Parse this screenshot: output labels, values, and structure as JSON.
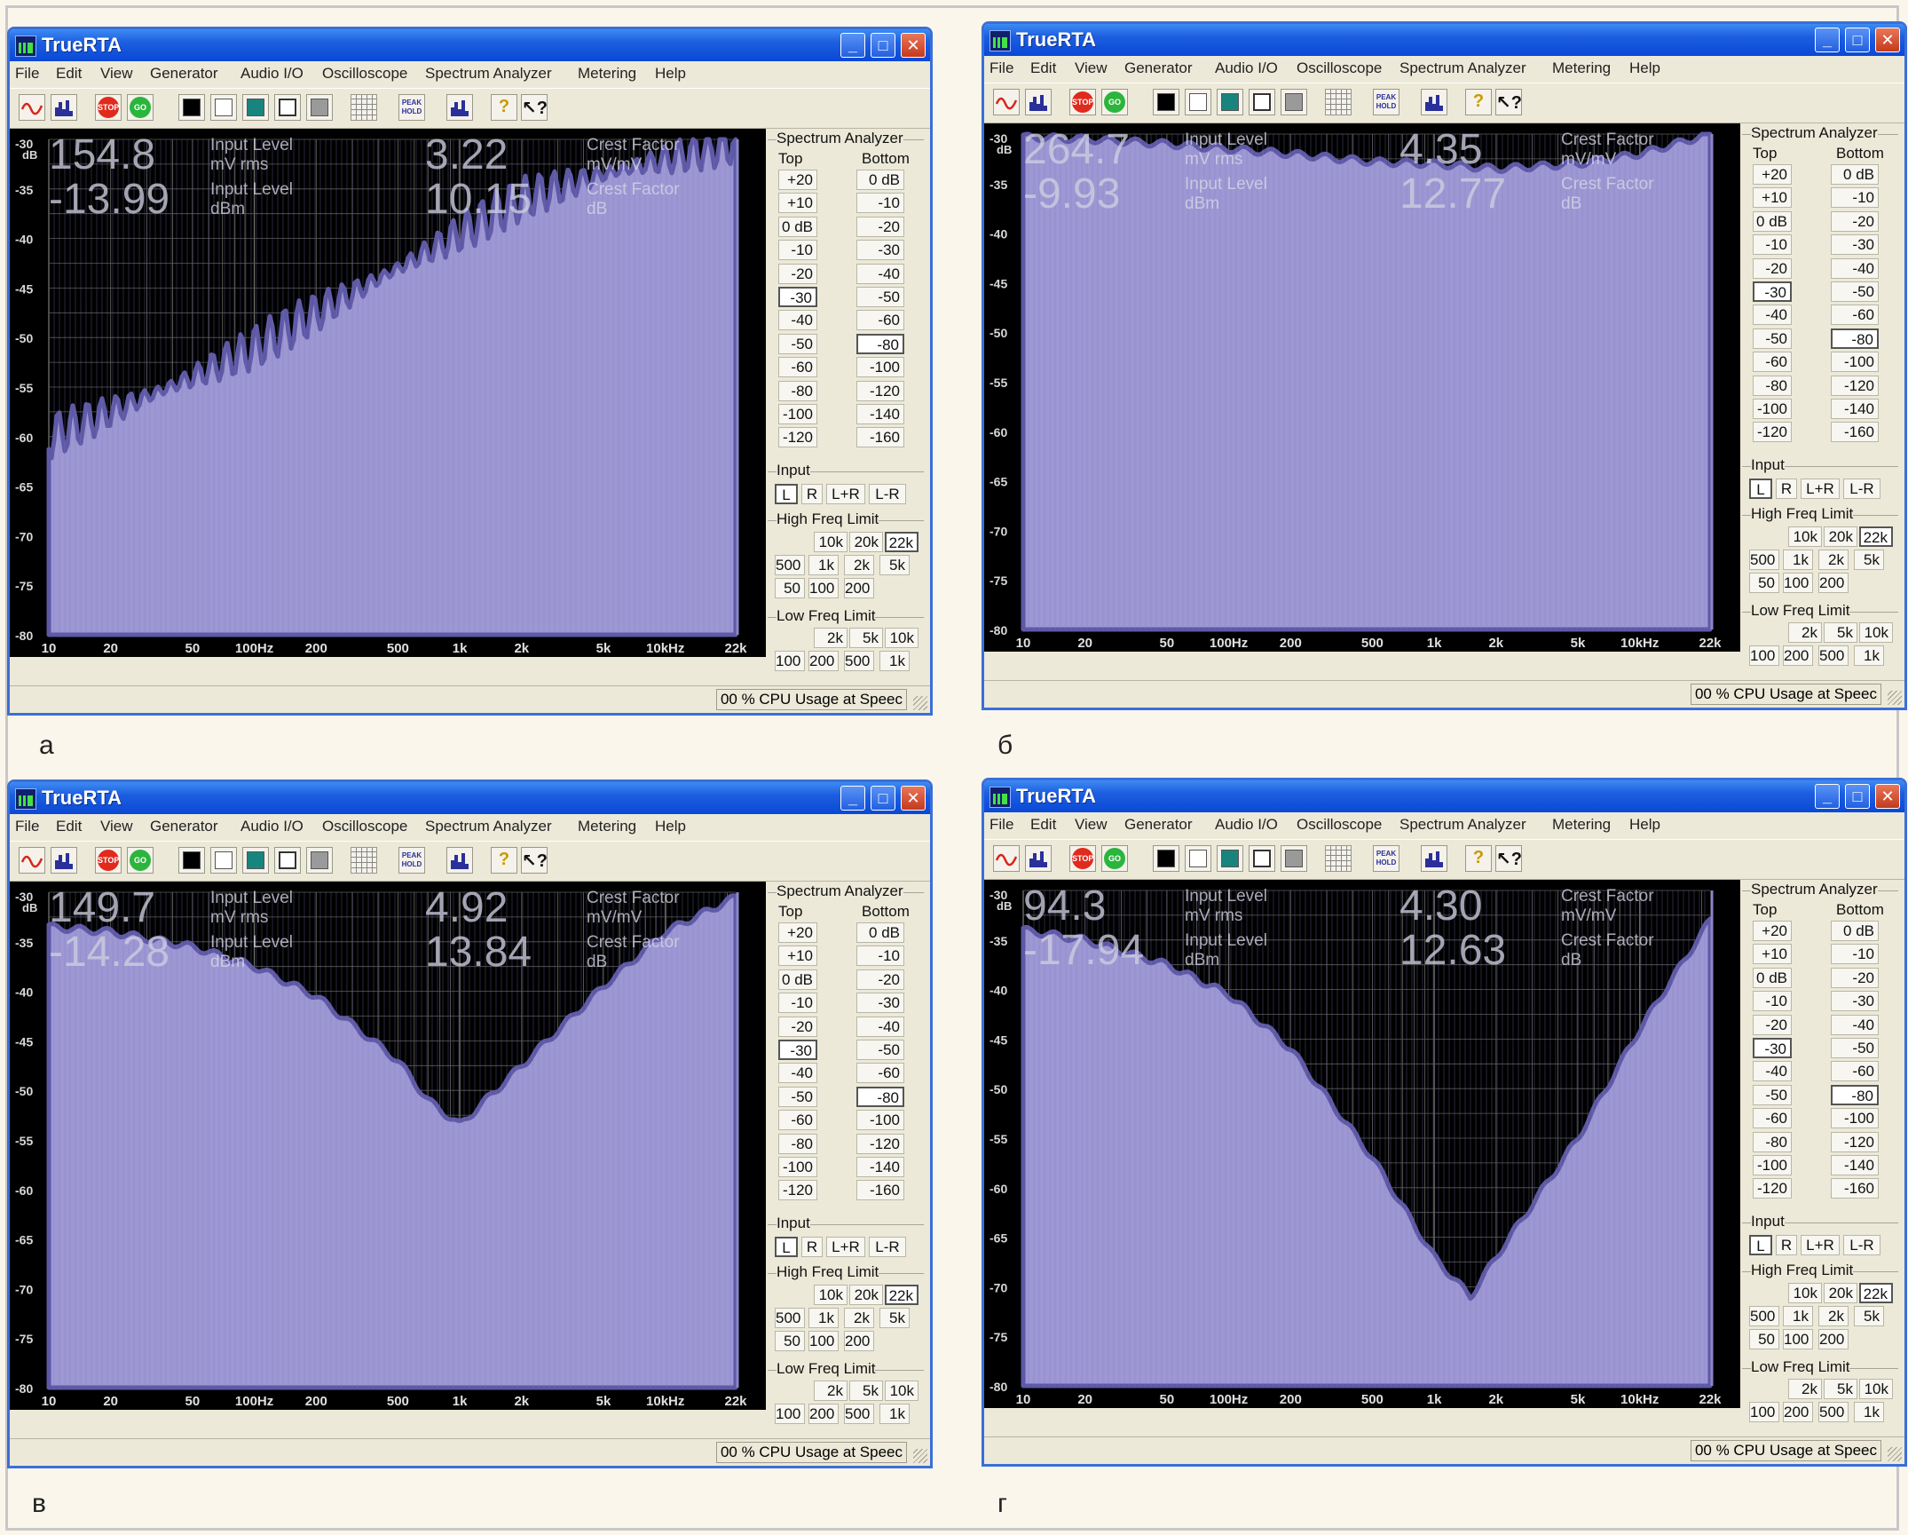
{
  "panel_labels": [
    "а",
    "б",
    "в",
    "г"
  ],
  "window": {
    "title": "TrueRTA",
    "menu": [
      "File",
      "Edit",
      "View",
      "Generator",
      "Audio I/O",
      "Oscilloscope",
      "Spectrum Analyzer",
      "Metering",
      "Help"
    ],
    "controls": {
      "minimize": "_",
      "maximize": "□",
      "close": "✕"
    }
  },
  "toolbar_icons": [
    "sine-wave-icon",
    "spectrum-icon",
    "stop-icon",
    "go-icon",
    "black-background-swatch",
    "white-background-swatch",
    "teal-background-swatch",
    "white-outline-swatch",
    "gray-background-swatch",
    "grid-icon",
    "peak-hold-icon",
    "bar-graph-icon",
    "help-icon",
    "context-help-icon"
  ],
  "toolbar_text": {
    "stop": "STOP",
    "go": "GO",
    "peak_hold": "PEAK HOLD",
    "help": "?",
    "context_help": "↖?"
  },
  "graph": {
    "y_axis_unit": "dB",
    "y_ticks": [
      "-30",
      "-35",
      "-40",
      "-45",
      "-50",
      "-55",
      "-60",
      "-65",
      "-70",
      "-75",
      "-80"
    ],
    "x_ticks": [
      "10",
      "20",
      "50",
      "100Hz",
      "200",
      "500",
      "1k",
      "2k",
      "5k",
      "10kHz",
      "22k"
    ],
    "labels": {
      "input_level_mv": "Input Level",
      "mv_rms": "mV rms",
      "input_level_dbm": "Input Level",
      "dbm": "dBm",
      "crest_factor_ratio": "Crest Factor",
      "mv_per_mv": "mV/mV",
      "crest_factor_db": "Crest Factor",
      "db": "dB"
    }
  },
  "side_panel": {
    "spectrum_analyzer": "Spectrum Analyzer",
    "top_label": "Top",
    "bottom_label": "Bottom",
    "top_buttons": [
      "+20",
      "+10",
      "0 dB",
      "-10",
      "-20",
      "-30",
      "-40",
      "-50",
      "-60",
      "-80",
      "-100",
      "-120"
    ],
    "bottom_buttons": [
      "0 dB",
      "-10",
      "-20",
      "-30",
      "-40",
      "-50",
      "-60",
      "-80",
      "-100",
      "-120",
      "-140",
      "-160"
    ],
    "top_selected": "-30",
    "bottom_selected": "-80",
    "input_label": "Input",
    "input_buttons": [
      "L",
      "R",
      "L+R",
      "L-R"
    ],
    "high_freq_label": "High Freq Limit",
    "high_freq_rows": [
      [
        "10k",
        "20k",
        "22k"
      ],
      [
        "500",
        "1k",
        "2k",
        "5k"
      ],
      [
        "50",
        "100",
        "200"
      ]
    ],
    "high_freq_selected": "22k",
    "low_freq_label": "Low Freq Limit",
    "low_freq_rows": [
      [
        "2k",
        "5k",
        "10k"
      ],
      [
        "100",
        "200",
        "500",
        "1k"
      ]
    ]
  },
  "status": {
    "cpu": "00 % CPU Usage at Speec"
  },
  "colors": {
    "spectrum_fill": "#9d97d3",
    "graph_background": "#000000",
    "titlebar": "#0a49d6"
  },
  "panels": [
    {
      "label": "а",
      "input_level_mv_rms": "154.8",
      "input_level_dbm": "-13.99",
      "crest_factor_mv": "3.22",
      "crest_factor_db": "10.15",
      "spectrum_db_by_freq": [
        [
          10,
          -60
        ],
        [
          20,
          -57.5
        ],
        [
          50,
          -54
        ],
        [
          100,
          -51
        ],
        [
          200,
          -47.5
        ],
        [
          500,
          -43
        ],
        [
          1000,
          -39.5
        ],
        [
          2000,
          -36
        ],
        [
          5000,
          -33.5
        ],
        [
          10000,
          -32
        ],
        [
          22000,
          -30.2
        ]
      ]
    },
    {
      "label": "б",
      "input_level_mv_rms": "264.7",
      "input_level_dbm": "-9.93",
      "crest_factor_mv": "4.35",
      "crest_factor_db": "12.77",
      "spectrum_db_by_freq": [
        [
          10,
          -30.3
        ],
        [
          20,
          -30.5
        ],
        [
          50,
          -31
        ],
        [
          100,
          -31.5
        ],
        [
          200,
          -32
        ],
        [
          500,
          -32.8
        ],
        [
          1000,
          -33
        ],
        [
          2000,
          -33.5
        ],
        [
          5000,
          -33
        ],
        [
          10000,
          -32
        ],
        [
          22000,
          -30
        ]
      ]
    },
    {
      "label": "в",
      "input_level_mv_rms": "149.7",
      "input_level_dbm": "-14.28",
      "crest_factor_mv": "4.92",
      "crest_factor_db": "13.84",
      "spectrum_db_by_freq": [
        [
          10,
          -33.5
        ],
        [
          20,
          -34
        ],
        [
          50,
          -35.5
        ],
        [
          100,
          -37.5
        ],
        [
          200,
          -40.5
        ],
        [
          500,
          -47
        ],
        [
          700,
          -51
        ],
        [
          1000,
          -53.5
        ],
        [
          2000,
          -47.5
        ],
        [
          5000,
          -39.5
        ],
        [
          10000,
          -34
        ],
        [
          22000,
          -30.5
        ]
      ]
    },
    {
      "label": "г",
      "input_level_mv_rms": "94.3",
      "input_level_dbm": "-17.94",
      "crest_factor_mv": "4.30",
      "crest_factor_db": "12.63",
      "spectrum_db_by_freq": [
        [
          10,
          -34
        ],
        [
          20,
          -35
        ],
        [
          50,
          -37.5
        ],
        [
          100,
          -40.5
        ],
        [
          200,
          -46
        ],
        [
          500,
          -57
        ],
        [
          1000,
          -67
        ],
        [
          1500,
          -71
        ],
        [
          2000,
          -67
        ],
        [
          5000,
          -55
        ],
        [
          10000,
          -44
        ],
        [
          22000,
          -33
        ]
      ]
    }
  ]
}
